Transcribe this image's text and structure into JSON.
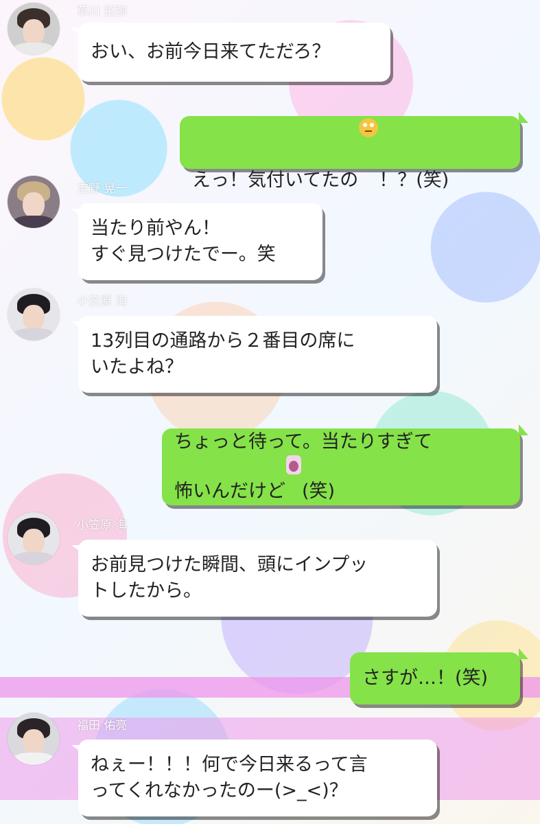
{
  "colors": {
    "incoming_bubble": "#ffffff",
    "outgoing_bubble": "#85e249",
    "pink_band": "#ee96eb",
    "sender_name": "#ffffff"
  },
  "messages": [
    {
      "side": "incoming",
      "sender": "草川 拓弥",
      "avatar": "avatar-kusakawa",
      "text": "おい、お前今日来てただろ？"
    },
    {
      "side": "outgoing",
      "text_before": "えっ！気付いてたの",
      "emoji": "rolling-eyes-emoji",
      "text_after": "！？(笑)"
    },
    {
      "side": "incoming",
      "sender": "吉野 晃一",
      "avatar": "avatar-yoshino",
      "text": "当たり前やん！\nすぐ見つけたでー。笑"
    },
    {
      "side": "incoming",
      "sender": "小笠原 海",
      "avatar": "avatar-ogasawara",
      "text": "13列目の通路から２番目の席に\nいたよね？"
    },
    {
      "side": "outgoing",
      "text_before": "ちょっと待って。当たりすぎて\n怖いんだけど",
      "emoji": "scream-emoji",
      "text_after": "(笑)"
    },
    {
      "side": "incoming",
      "sender": "小笠原 海",
      "avatar": "avatar-ogasawara",
      "text": "お前見つけた瞬間、頭にインプッ\nトしたから。"
    },
    {
      "side": "outgoing",
      "text_before": "さすが…！(笑)",
      "emoji": "",
      "text_after": ""
    },
    {
      "side": "incoming",
      "sender": "福田 佑亮",
      "avatar": "avatar-fukuda",
      "text": "ねぇー！！！何で今日来るって言\nってくれなかったのー(>_<)？"
    }
  ]
}
